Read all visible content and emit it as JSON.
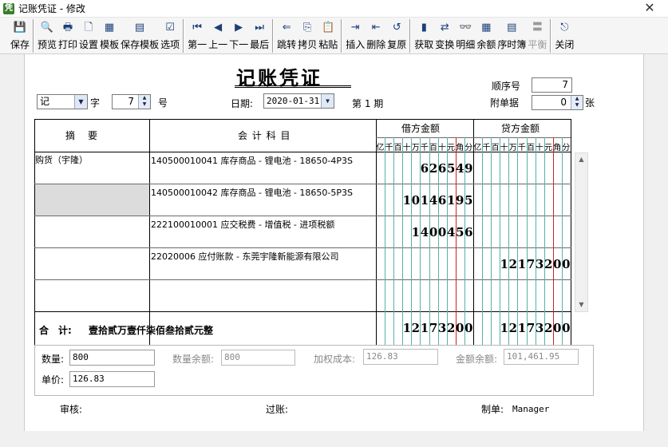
{
  "window": {
    "title": "记账凭证 - 修改",
    "app_icon": "voucher-app-icon",
    "close_label": "✕"
  },
  "toolbar": {
    "groups": [
      [
        {
          "label": "保存",
          "icon": "save-icon",
          "glyph": "💾"
        }
      ],
      [
        {
          "label": "预览",
          "icon": "preview-icon",
          "glyph": "🔍"
        },
        {
          "label": "打印",
          "icon": "print-icon",
          "glyph": "🖶"
        },
        {
          "label": "设置",
          "icon": "settings-icon",
          "glyph": "🗋"
        },
        {
          "label": "模板",
          "icon": "template-icon",
          "glyph": "▦"
        },
        {
          "label": "保存模板",
          "icon": "save-template-icon",
          "glyph": "▤"
        },
        {
          "label": "选项",
          "icon": "options-icon",
          "glyph": "☑"
        }
      ],
      [
        {
          "label": "第一",
          "icon": "first-icon",
          "glyph": "⏮"
        },
        {
          "label": "上一",
          "icon": "prev-icon",
          "glyph": "◀"
        },
        {
          "label": "下一",
          "icon": "next-icon",
          "glyph": "▶"
        },
        {
          "label": "最后",
          "icon": "last-icon",
          "glyph": "⏭"
        }
      ],
      [
        {
          "label": "跳转",
          "icon": "jump-icon",
          "glyph": "⇐"
        },
        {
          "label": "拷贝",
          "icon": "copy-icon",
          "glyph": "⎘"
        },
        {
          "label": "粘贴",
          "icon": "paste-icon",
          "glyph": "📋"
        }
      ],
      [
        {
          "label": "插入",
          "icon": "insert-row-icon",
          "glyph": "⇥"
        },
        {
          "label": "删除",
          "icon": "delete-row-icon",
          "glyph": "⇤"
        },
        {
          "label": "复原",
          "icon": "restore-icon",
          "glyph": "↺"
        }
      ],
      [
        {
          "label": "获取",
          "icon": "fetch-icon",
          "glyph": "▮"
        },
        {
          "label": "变换",
          "icon": "transform-icon",
          "glyph": "⇄"
        },
        {
          "label": "明细",
          "icon": "detail-icon",
          "glyph": "👓"
        },
        {
          "label": "余额",
          "icon": "balance-icon",
          "glyph": "▦"
        },
        {
          "label": "序时簿",
          "icon": "journal-icon",
          "glyph": "▤"
        },
        {
          "label": "平衡",
          "icon": "balance-check-icon",
          "glyph": "〓",
          "disabled": true
        }
      ],
      [
        {
          "label": "关闭",
          "icon": "exit-icon",
          "glyph": "⎋"
        }
      ]
    ]
  },
  "header": {
    "voucher_title": "记账凭证",
    "word_select": "记",
    "word_label": "字",
    "number_value": "7",
    "number_label": "号",
    "date_label": "日期:",
    "date_value": "2020-01-31",
    "period_text": "第 1 期",
    "seq_label": "顺序号",
    "seq_value": "7",
    "attach_label": "附单据",
    "attach_value": "0",
    "attach_unit": "张"
  },
  "table": {
    "col_summary": "摘　要",
    "col_account": "会 计 科 目",
    "col_debit": "借方金额",
    "col_credit": "贷方金额",
    "unit_headers": [
      "亿",
      "千",
      "百",
      "十",
      "万",
      "千",
      "百",
      "十",
      "元",
      "角",
      "分"
    ],
    "rows": [
      {
        "summary": "购货（宇隆）",
        "account": "140500010041 库存商品 - 锂电池 - 18650-4P3S",
        "debit": "626549",
        "credit": ""
      },
      {
        "summary": "",
        "account": "140500010042 库存商品 - 锂电池 - 18650-5P3S",
        "debit": "10146195",
        "credit": ""
      },
      {
        "summary": "",
        "account": "222100010001 应交税费 - 增值税 - 进项税额",
        "debit": "1400456",
        "credit": ""
      },
      {
        "summary": "",
        "account": "22020006 应付账款 - 东莞宇隆新能源有限公司",
        "debit": "",
        "credit": "12173200"
      },
      {
        "summary": "",
        "account": "",
        "debit": "",
        "credit": ""
      }
    ],
    "total_label": "合　计:",
    "total_words": "壹拾贰万壹仟柒佰叁拾贰元整",
    "total_debit": "12173200",
    "total_credit": "12173200"
  },
  "details": {
    "qty_label": "数量:",
    "qty_value": "800",
    "qty_balance_label": "数量余额:",
    "qty_balance_value": "800",
    "weighted_cost_label": "加权成本:",
    "weighted_cost_value": "126.83",
    "amount_balance_label": "金额余额:",
    "amount_balance_value": "101,461.95",
    "price_label": "单价:",
    "price_value": "126.83"
  },
  "signatures": {
    "review_label": "审核:",
    "post_label": "过账:",
    "maker_label": "制单:",
    "maker_value": "Manager"
  }
}
